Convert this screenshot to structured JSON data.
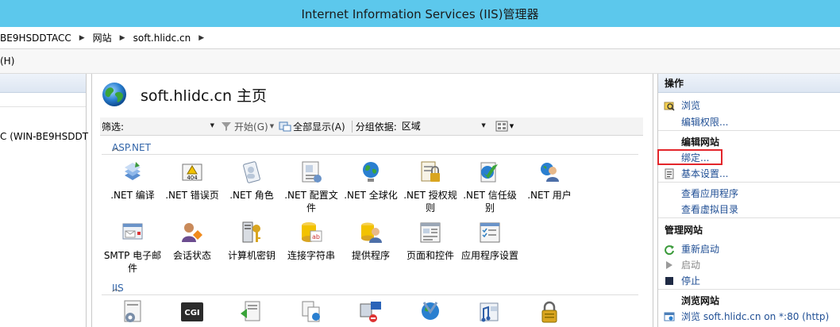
{
  "window": {
    "title": "Internet Information Services (IIS)管理器"
  },
  "breadcrumb": [
    "BE9HSDDTACC",
    "网站",
    "soft.hlidc.cn"
  ],
  "menu": {
    "help": "(H)"
  },
  "connections": {
    "server_node": "C (WIN-BE9HSDDT"
  },
  "page": {
    "title": "soft.hlidc.cn 主页"
  },
  "filter": {
    "label": "筛选:",
    "start": "开始(G)",
    "showall": "全部显示(A)",
    "groupby_label": "分组依据:",
    "groupby_value": "区域"
  },
  "sections": {
    "aspnet": "ASP.NET",
    "iis": "IIS"
  },
  "aspnet_features": [
    {
      "label": ".NET 编译",
      "icon": "net-compile-icon"
    },
    {
      "label": ".NET 错误页",
      "icon": "net-error-pages-icon"
    },
    {
      "label": ".NET 角色",
      "icon": "net-roles-icon"
    },
    {
      "label": ".NET 配置文件",
      "icon": "net-profile-icon"
    },
    {
      "label": ".NET 全球化",
      "icon": "net-globalization-icon"
    },
    {
      "label": ".NET 授权规则",
      "icon": "net-authorization-icon"
    },
    {
      "label": ".NET 信任级别",
      "icon": "net-trust-levels-icon"
    },
    {
      "label": ".NET 用户",
      "icon": "net-users-icon"
    },
    {
      "label": "SMTP 电子邮件",
      "icon": "smtp-email-icon"
    },
    {
      "label": "会话状态",
      "icon": "session-state-icon"
    },
    {
      "label": "计算机密钥",
      "icon": "machine-key-icon"
    },
    {
      "label": "连接字符串",
      "icon": "connection-strings-icon"
    },
    {
      "label": "提供程序",
      "icon": "providers-icon"
    },
    {
      "label": "页面和控件",
      "icon": "pages-controls-icon"
    },
    {
      "label": "应用程序设置",
      "icon": "app-settings-icon"
    }
  ],
  "iis_features": [
    {
      "icon": "asp-icon"
    },
    {
      "icon": "cgi-icon",
      "badge": "CGI"
    },
    {
      "icon": "compression-icon"
    },
    {
      "icon": "default-document-icon"
    },
    {
      "icon": "directory-browsing-icon"
    },
    {
      "icon": "error-pages-icon"
    },
    {
      "icon": "handler-mappings-icon"
    },
    {
      "icon": "authentication-icon"
    }
  ],
  "actions": {
    "header": "操作",
    "explore": "浏览",
    "edit_permissions": "编辑权限...",
    "edit_site_header": "编辑网站",
    "bindings": "绑定...",
    "basic_settings": "基本设置...",
    "view_applications": "查看应用程序",
    "view_virtual_dirs": "查看虚拟目录",
    "manage_site_header": "管理网站",
    "restart": "重新启动",
    "start": "启动",
    "stop": "停止",
    "browse_site_header": "浏览网站",
    "browse_link": "浏览 soft.hlidc.cn on *:80 (http)"
  },
  "colors": {
    "titlebar": "#5cc8ec",
    "link": "#1f4e94",
    "highlight": "#e3262b",
    "section": "#3366aa"
  }
}
